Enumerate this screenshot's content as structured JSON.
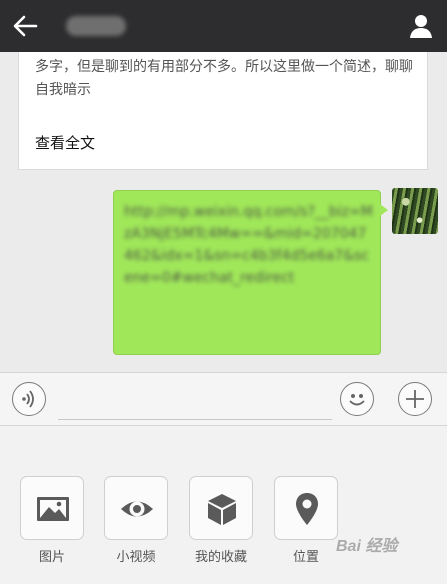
{
  "header": {
    "back_icon": "arrow-left-icon",
    "contact_icon": "person-icon"
  },
  "chat": {
    "card": {
      "text": "多字，但是聊到的有用部分不多。所以这里做一个简述，聊聊自我暗示",
      "link_label": "查看全文"
    },
    "outgoing_message": {
      "text": "http://mp.weixin.qq.com/s?__biz=MzA3NjE5MTc4Mw==&mid=207047462&idx=1&sn=c4b3f4d5e6a7&scene=0#wechat_redirect"
    }
  },
  "input_bar": {
    "voice_icon": "voice-icon",
    "emoji_icon": "emoji-icon",
    "plus_icon": "plus-icon",
    "placeholder": ""
  },
  "panel": {
    "items": [
      {
        "label": "图片",
        "icon": "picture-icon"
      },
      {
        "label": "小视频",
        "icon": "eye-icon"
      },
      {
        "label": "我的收藏",
        "icon": "box-icon"
      },
      {
        "label": "位置",
        "icon": "location-pin-icon"
      }
    ]
  },
  "watermark": "Bai 经验",
  "colors": {
    "header_bg": "#2d2d2f",
    "bubble_green": "#a0e75a",
    "chat_bg": "#ebebeb"
  }
}
